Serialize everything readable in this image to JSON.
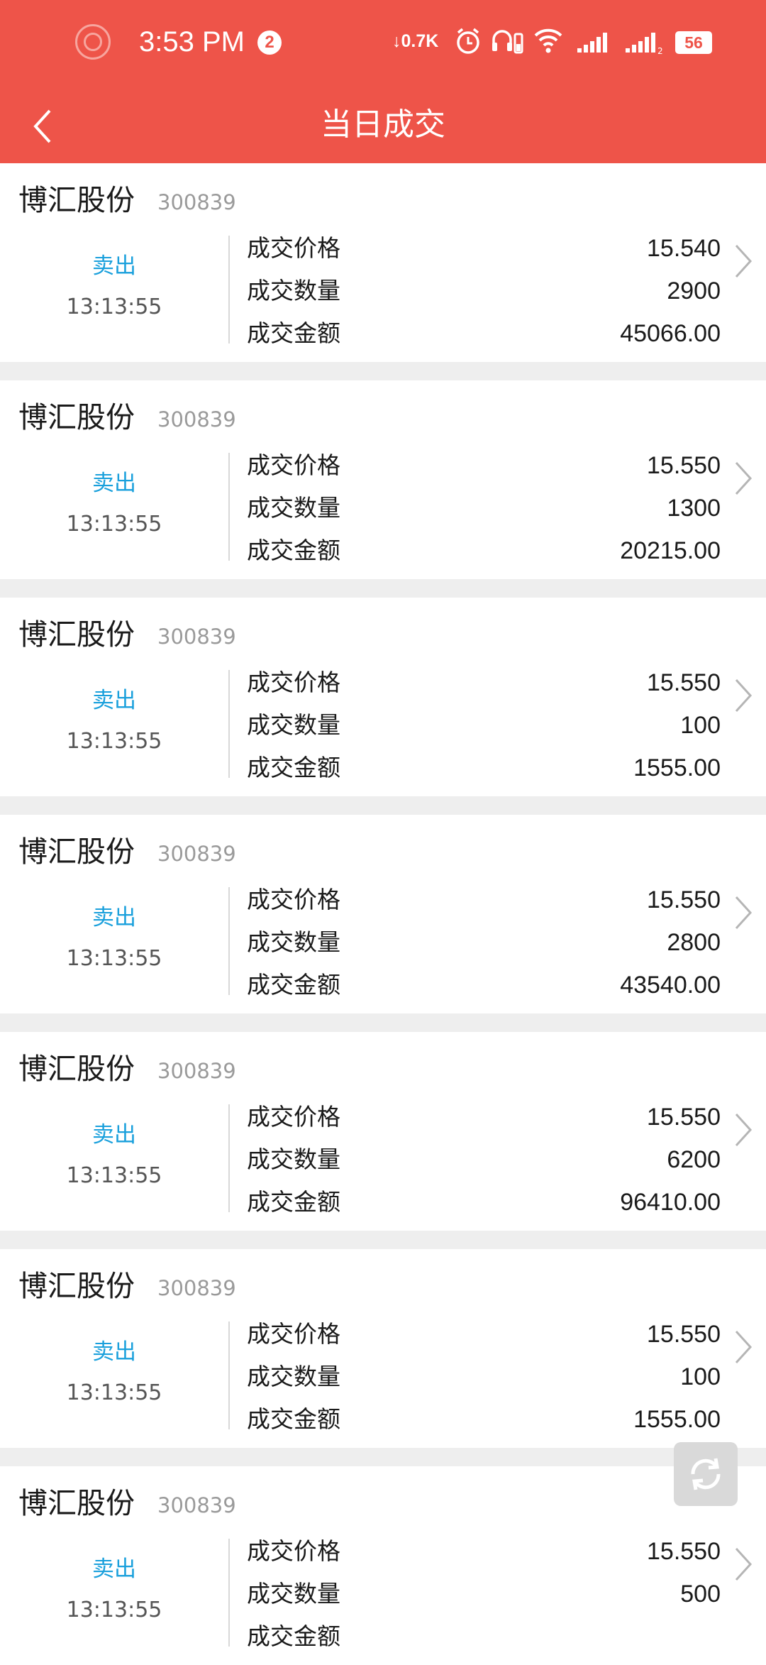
{
  "status_bar": {
    "time": "3:53 PM",
    "notification_count": "2",
    "net_speed": "0.7K",
    "battery": "56"
  },
  "header": {
    "title": "当日成交"
  },
  "labels": {
    "price": "成交价格",
    "qty": "成交数量",
    "amount": "成交金额"
  },
  "trades": [
    {
      "name": "博汇股份",
      "code": "300839",
      "side": "卖出",
      "time": "13:13:55",
      "price": "15.540",
      "qty": "2900",
      "amount": "45066.00"
    },
    {
      "name": "博汇股份",
      "code": "300839",
      "side": "卖出",
      "time": "13:13:55",
      "price": "15.550",
      "qty": "1300",
      "amount": "20215.00"
    },
    {
      "name": "博汇股份",
      "code": "300839",
      "side": "卖出",
      "time": "13:13:55",
      "price": "15.550",
      "qty": "100",
      "amount": "1555.00"
    },
    {
      "name": "博汇股份",
      "code": "300839",
      "side": "卖出",
      "time": "13:13:55",
      "price": "15.550",
      "qty": "2800",
      "amount": "43540.00"
    },
    {
      "name": "博汇股份",
      "code": "300839",
      "side": "卖出",
      "time": "13:13:55",
      "price": "15.550",
      "qty": "6200",
      "amount": "96410.00"
    },
    {
      "name": "博汇股份",
      "code": "300839",
      "side": "卖出",
      "time": "13:13:55",
      "price": "15.550",
      "qty": "100",
      "amount": "1555.00"
    },
    {
      "name": "博汇股份",
      "code": "300839",
      "side": "卖出",
      "time": "13:13:55",
      "price": "15.550",
      "qty": "500",
      "amount": ""
    }
  ],
  "colors": {
    "header": "#ee5449",
    "sell": "#1aa0dc"
  }
}
